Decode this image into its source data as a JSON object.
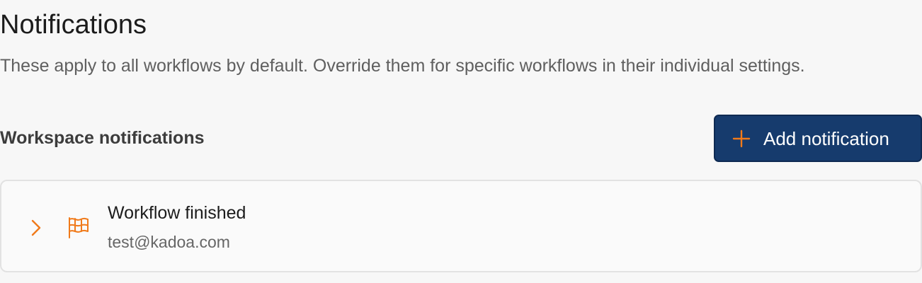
{
  "header": {
    "title": "Notifications",
    "subtitle": "These apply to all workflows by default. Override them for specific workflows in their individual settings."
  },
  "section": {
    "title": "Workspace notifications",
    "add_button_label": "Add notification",
    "add_button_icon": "plus-icon"
  },
  "notifications": [
    {
      "title": "Workflow finished",
      "recipient": "test@kadoa.com",
      "icon": "flag-icon",
      "expand_icon": "chevron-right-icon"
    }
  ],
  "colors": {
    "accent": "#f07a1a",
    "button_bg": "#163b6d",
    "background": "#f7f7f7"
  }
}
